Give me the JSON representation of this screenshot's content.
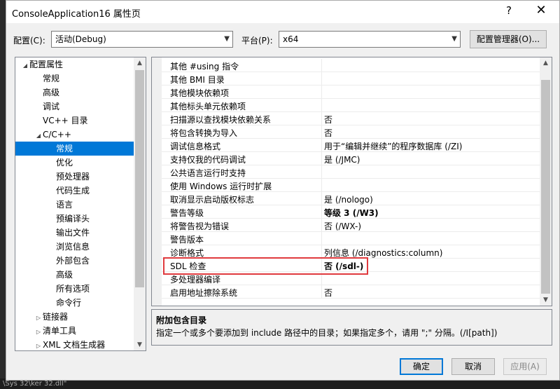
{
  "window": {
    "title": "ConsoleApplication16 属性页",
    "help_symbol": "?",
    "close_symbol": "✕"
  },
  "toolbar": {
    "config_label": "配置(C):",
    "config_value": "活动(Debug)",
    "platform_label": "平台(P):",
    "platform_value": "x64",
    "config_manager_button": "配置管理器(O)..."
  },
  "tree": {
    "items": [
      {
        "label": "配置属性",
        "twisty": "◢"
      },
      {
        "label": "常规"
      },
      {
        "label": "高级"
      },
      {
        "label": "调试"
      },
      {
        "label": "VC++ 目录"
      },
      {
        "label": "C/C++",
        "twisty": "◢"
      },
      {
        "label": "常规",
        "selected": true
      },
      {
        "label": "优化"
      },
      {
        "label": "预处理器"
      },
      {
        "label": "代码生成"
      },
      {
        "label": "语言"
      },
      {
        "label": "预编译头"
      },
      {
        "label": "输出文件"
      },
      {
        "label": "浏览信息"
      },
      {
        "label": "外部包含"
      },
      {
        "label": "高级"
      },
      {
        "label": "所有选项"
      },
      {
        "label": "命令行"
      },
      {
        "label": "链接器",
        "twisty": "▷"
      },
      {
        "label": "清单工具",
        "twisty": "▷"
      },
      {
        "label": "XML 文档生成器",
        "twisty": "▷"
      }
    ]
  },
  "grid": {
    "rows": [
      {
        "name": "其他 #using 指令",
        "value": ""
      },
      {
        "name": "其他 BMI 目录",
        "value": ""
      },
      {
        "name": "其他模块依赖项",
        "value": ""
      },
      {
        "name": "其他标头单元依赖项",
        "value": ""
      },
      {
        "name": "扫描源以查找模块依赖关系",
        "value": "否"
      },
      {
        "name": "将包含转换为导入",
        "value": "否"
      },
      {
        "name": "调试信息格式",
        "value": "用于“编辑并继续”的程序数据库 (/ZI)"
      },
      {
        "name": "支持仅我的代码调试",
        "value": "是 (/JMC)"
      },
      {
        "name": "公共语言运行时支持",
        "value": ""
      },
      {
        "name": "使用 Windows 运行时扩展",
        "value": ""
      },
      {
        "name": "取消显示启动版权标志",
        "value": "是 (/nologo)"
      },
      {
        "name": "警告等级",
        "value": "等级 3 (/W3)",
        "bold": true
      },
      {
        "name": "将警告视为错误",
        "value": "否 (/WX-)"
      },
      {
        "name": "警告版本",
        "value": ""
      },
      {
        "name": "诊断格式",
        "value": "列信息 (/diagnostics:column)"
      },
      {
        "name": "SDL 检查",
        "value": "否 (/sdl-)",
        "bold": true
      },
      {
        "name": "多处理器编译",
        "value": ""
      },
      {
        "name": "启用地址擦除系统",
        "value": "否"
      }
    ]
  },
  "description": {
    "title": "附加包含目录",
    "text": "指定一个或多个要添加到 include 路径中的目录；如果指定多个，请用 \";\" 分隔。(/I[path])"
  },
  "buttons": {
    "ok": "确定",
    "cancel": "取消",
    "apply": "应用(A)"
  },
  "background": {
    "bottom_text": "\\Sys  32\\ker  32.dll\""
  }
}
